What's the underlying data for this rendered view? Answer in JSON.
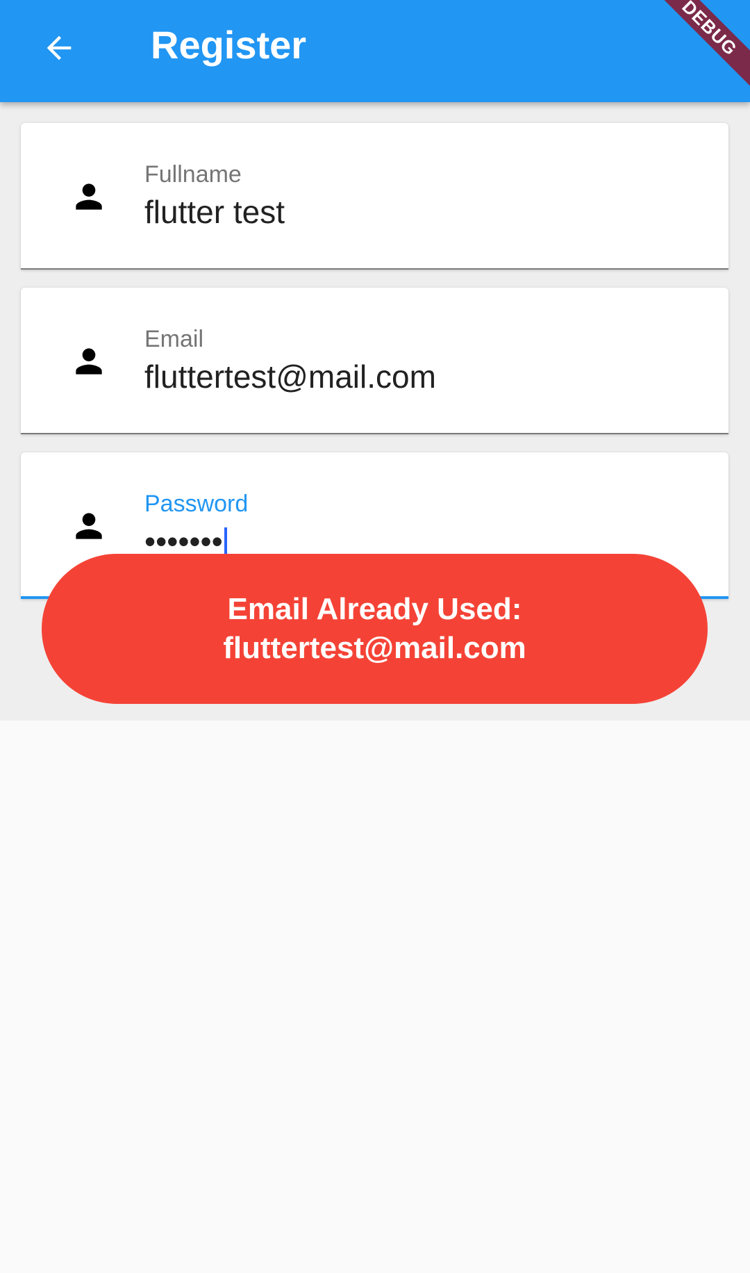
{
  "app_bar": {
    "title": "Register",
    "back_icon": "arrow-back-icon",
    "color": "#2196f3"
  },
  "debug_banner": {
    "label": "DEBUG",
    "color": "#7b2a4a"
  },
  "form": {
    "fields": [
      {
        "label": "Fullname",
        "value": "flutter test",
        "icon": "person-icon",
        "focused": false
      },
      {
        "label": "Email",
        "value": "fluttertest@mail.com",
        "icon": "person-icon",
        "focused": false
      },
      {
        "label": "Password",
        "value": "•••••••",
        "icon": "person-icon",
        "focused": true
      }
    ],
    "focus_color": "#2196f3"
  },
  "snackbar": {
    "message": "Email Already Used:\nfluttertest@mail.com",
    "color": "#f44336"
  }
}
